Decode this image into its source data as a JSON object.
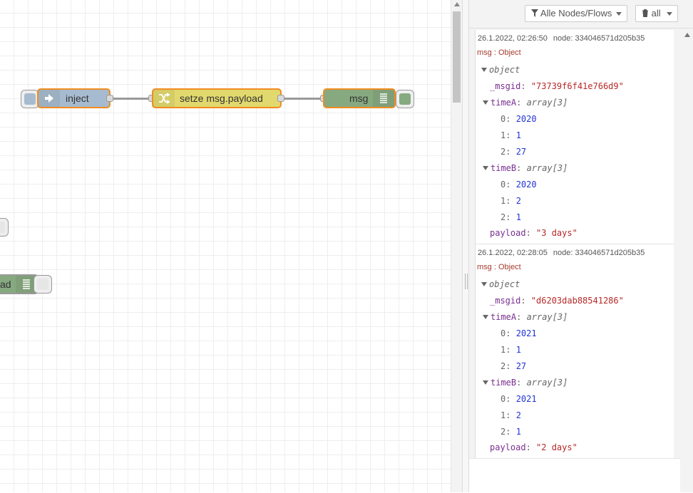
{
  "flow": {
    "inject_label": "inject",
    "change_label": "setze msg.payload",
    "debug_label": "msg",
    "partial_debug_label": "ad",
    "colors": {
      "inject": "#a6bbcf",
      "change": "#e2d96e",
      "debug": "#87a980",
      "node_border": "#f28c1f"
    }
  },
  "sidebar": {
    "filter_label": "Alle Nodes/Flows",
    "clear_label": "all",
    "messages": [
      {
        "timestamp": "26.1.2022, 02:26:50",
        "node": "node: 334046571d205b35",
        "topic": "msg : Object",
        "root": "object",
        "msgid_key": "_msgid",
        "msgid_value": "\"73739f6f41e766d9\"",
        "timeA_key": "timeA",
        "timeA_type": "array[3]",
        "timeA": [
          "2020",
          "1",
          "27"
        ],
        "timeB_key": "timeB",
        "timeB_type": "array[3]",
        "timeB": [
          "2020",
          "2",
          "1"
        ],
        "payload_key": "payload",
        "payload_value": "\"3 days\""
      },
      {
        "timestamp": "26.1.2022, 02:28:05",
        "node": "node: 334046571d205b35",
        "topic": "msg : Object",
        "root": "object",
        "msgid_key": "_msgid",
        "msgid_value": "\"d6203dab88541286\"",
        "timeA_key": "timeA",
        "timeA_type": "array[3]",
        "timeA": [
          "2021",
          "1",
          "27"
        ],
        "timeB_key": "timeB",
        "timeB_type": "array[3]",
        "timeB": [
          "2021",
          "2",
          "1"
        ],
        "payload_key": "payload",
        "payload_value": "\"2 days\""
      }
    ]
  },
  "indices": [
    "0",
    "1",
    "2"
  ]
}
